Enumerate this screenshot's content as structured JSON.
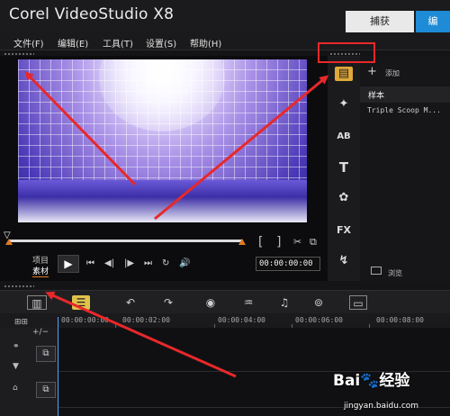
{
  "window": {
    "app_title": "Corel VideoStudio X8",
    "tabs": [
      {
        "label": "捕获"
      },
      {
        "label": "编"
      }
    ]
  },
  "menu": {
    "items": [
      {
        "label": "文件(F)"
      },
      {
        "label": "编辑(E)"
      },
      {
        "label": "工具(T)"
      },
      {
        "label": "设置(S)"
      },
      {
        "label": "帮助(H)"
      }
    ]
  },
  "player": {
    "mode_project": "项目",
    "mode_clip": "素材",
    "timecode": "00:00:00:00",
    "bracket_in": "[",
    "bracket_out": "]"
  },
  "library": {
    "add_label": "添加",
    "header": "样本",
    "entries": [
      "Triple Scoop M..."
    ],
    "browse_label": "浏览"
  },
  "timeline": {
    "ruler_labels": [
      "00:00:00:00",
      "00:00:02:00",
      "00:00:04:00",
      "00:00:06:00",
      "00:00:08:00"
    ],
    "track_add_label": "+/−"
  },
  "watermark": {
    "logo": "Bai🐾经验",
    "url": "jingyan.baidu.com"
  },
  "colors": {
    "accent_blue": "#1e8bd6",
    "annotation_red": "#e8282b",
    "trim_orange": "#e07a22"
  }
}
